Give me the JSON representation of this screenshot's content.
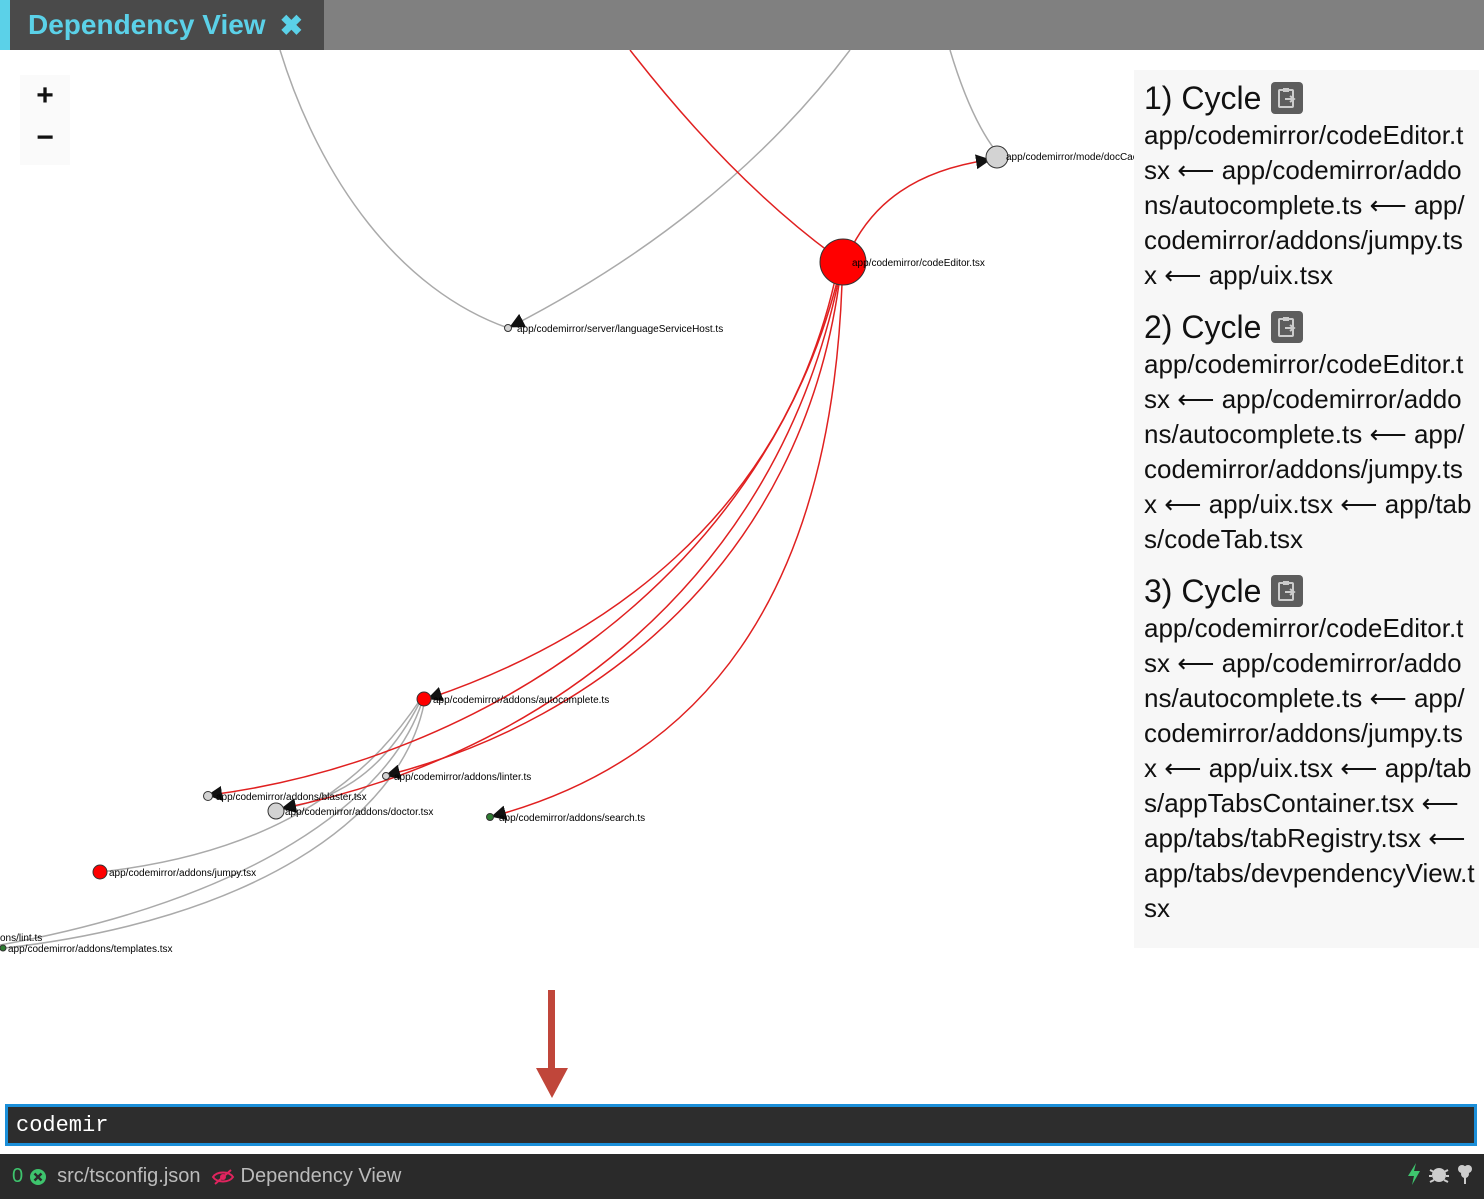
{
  "tab": {
    "title": "Dependency View",
    "close": "✖"
  },
  "zoom": {
    "in": "+",
    "out": "−"
  },
  "graph": {
    "nodes": [
      {
        "label": "app/codemirror/mode/docCache.ts",
        "status": "normal"
      },
      {
        "label": "app/codemirror/codeEditor.tsx",
        "status": "cycle"
      },
      {
        "label": "app/codemirror/server/languageServiceHost.ts",
        "status": "normal"
      },
      {
        "label": "app/codemirror/addons/autocomplete.ts",
        "status": "cycle"
      },
      {
        "label": "app/codemirror/addons/linter.ts",
        "status": "normal"
      },
      {
        "label": "app/codemirror/addons/blaster.tsx",
        "status": "normal"
      },
      {
        "label": "app/codemirror/addons/doctor.tsx",
        "status": "normal"
      },
      {
        "label": "app/codemirror/addons/search.ts",
        "status": "leaf"
      },
      {
        "label": "app/codemirror/addons/jumpy.tsx",
        "status": "cycle"
      },
      {
        "label": "ons/lint.ts",
        "status": "normal"
      },
      {
        "label": "app/codemirror/addons/templates.tsx",
        "status": "leaf"
      }
    ],
    "colors": {
      "cycle": "#ff0000",
      "normal": "#d3d3d3",
      "leaf": "#2e7d32",
      "edge": "#aaaaaa",
      "cycle_edge": "#e02020"
    }
  },
  "cycles": [
    {
      "title": "1) Cycle",
      "path": "app/codemirror/codeEditor.tsx ⟵ app/codemirror/addons/autocomplete.ts ⟵ app/codemirror/addons/jumpy.tsx ⟵ app/uix.tsx"
    },
    {
      "title": "2) Cycle",
      "path": "app/codemirror/codeEditor.tsx ⟵ app/codemirror/addons/autocomplete.ts ⟵ app/codemirror/addons/jumpy.tsx ⟵ app/uix.tsx ⟵ app/tabs/codeTab.tsx"
    },
    {
      "title": "3) Cycle",
      "path": "app/codemirror/codeEditor.tsx ⟵ app/codemirror/addons/autocomplete.ts ⟵ app/codemirror/addons/jumpy.tsx ⟵ app/uix.tsx ⟵ app/tabs/appTabsContainer.tsx ⟵ app/tabs/tabRegistry.tsx ⟵ app/tabs/devpendencyView.tsx"
    }
  ],
  "search": {
    "value": "codemir"
  },
  "status": {
    "error_count": "0",
    "project_file": "src/tsconfig.json",
    "active_view": "Dependency View"
  }
}
